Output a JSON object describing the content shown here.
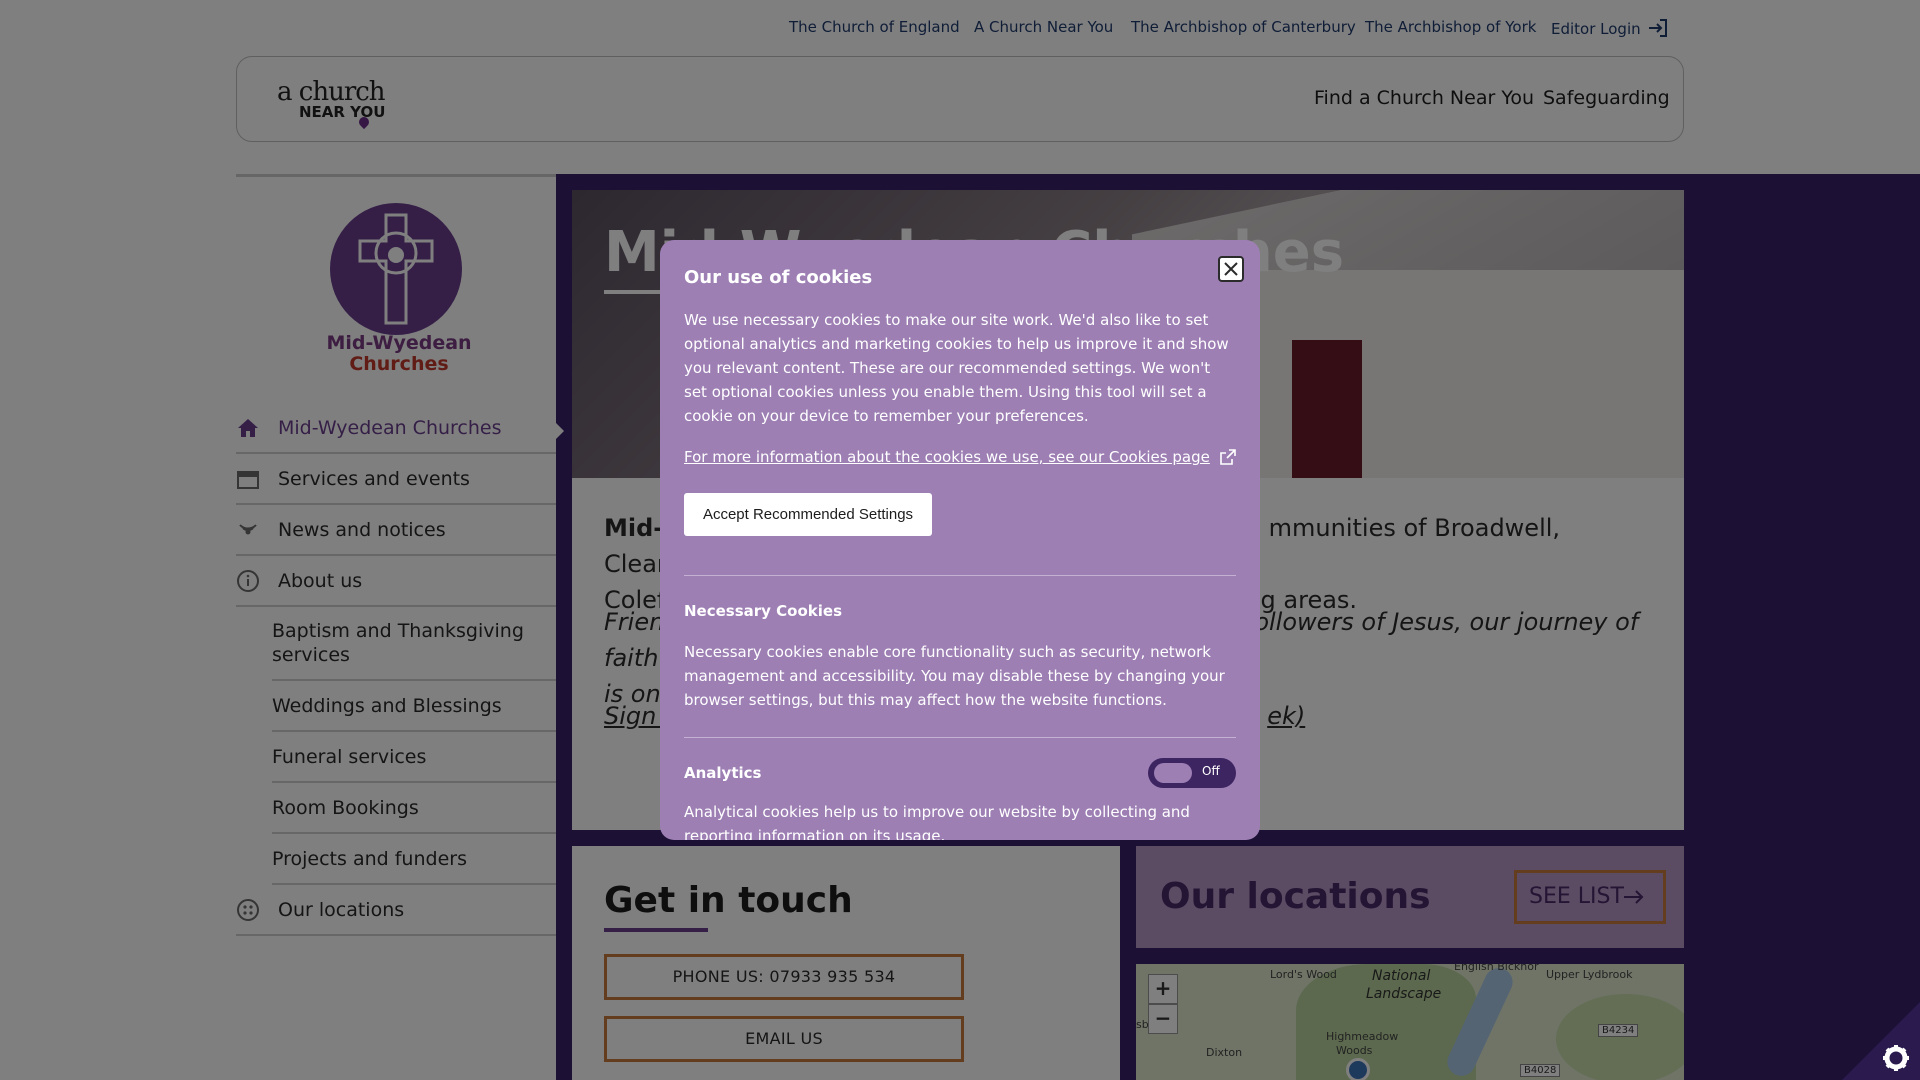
{
  "top_links": [
    {
      "label": "The Church of England"
    },
    {
      "label": "A Church Near You"
    },
    {
      "label": "The Archbishop of Canterbury"
    },
    {
      "label": "The Archbishop of York"
    },
    {
      "label": "Editor Login"
    }
  ],
  "logo": {
    "top": "a church",
    "bottom": "NEAR YOU"
  },
  "main_nav": [
    {
      "label": "Find a Church Near You"
    },
    {
      "label": "Safeguarding"
    }
  ],
  "church": {
    "name_line1": "Mid-Wyedean",
    "name_line2": "Churches"
  },
  "sidebar": {
    "items": [
      {
        "label": "Mid-Wyedean Churches",
        "icon": "home-icon"
      },
      {
        "label": "Services and events",
        "icon": "calendar-icon"
      },
      {
        "label": "News and notices",
        "icon": "broadcast-icon"
      },
      {
        "label": "About us",
        "icon": "info-icon"
      },
      {
        "label": "Baptism and Thanksgiving services"
      },
      {
        "label": "Weddings and Blessings"
      },
      {
        "label": "Funeral services"
      },
      {
        "label": "Room Bookings"
      },
      {
        "label": "Projects and funders"
      },
      {
        "label": "Our locations",
        "icon": "locations-icon"
      }
    ]
  },
  "hero": {
    "title": "Mid-Wyedean Churches"
  },
  "intro": {
    "p1_strong": "Mid-W",
    "p1_rest": "mmunities of Broadwell, Clearwell,",
    "p1_line2a": "Colef",
    "p1_line2b": "ng areas.",
    "p2a": "Frien",
    "p2b": "ollowers of Jesus, our journey of faith",
    "p2c": "is one",
    "p3a": "Sign u",
    "p3b": "ek)"
  },
  "touch": {
    "title": "Get in touch",
    "phone": "PHONE US: 07933 935 534",
    "email": "EMAIL US"
  },
  "locations": {
    "title": "Our locations",
    "see_list": "SEE LIST"
  },
  "map": {
    "zoom_in": "+",
    "zoom_out": "−",
    "labels": {
      "national": "National",
      "landscape": "Landscape",
      "lords_wood": "Lord's Wood",
      "english_bicknor": "English Bicknor",
      "upper_lydbrook": "Upper Lydbrook",
      "highmeadow": "Highmeadow",
      "woods": "Woods",
      "dixton": "Dixton",
      "b4234": "B4234",
      "b4028": "B4028",
      "sb": "sb"
    }
  },
  "cookie": {
    "title": "Our use of cookies",
    "intro": "We use necessary cookies to make our site work. We'd also like to set optional analytics and marketing cookies to help us improve it and show you relevant content. These are our recommended settings. We won't set optional cookies unless you enable them. Using this tool will set a cookie on your device to remember your preferences.",
    "more_info": "For more information about the cookies we use, see our Cookies page",
    "accept": "Accept Recommended Settings",
    "necessary_title": "Necessary Cookies",
    "necessary_text": "Necessary cookies enable core functionality such as security, network management and accessibility. You may disable these by changing your browser settings, but this may affect how the website functions.",
    "analytics_title": "Analytics",
    "analytics_toggle": "Off",
    "analytics_text": "Analytical cookies help us to improve our website by collecting and reporting information on its usage."
  },
  "colors": {
    "purple_band": "#3b206a",
    "modal_bg": "#9d7fb4",
    "accent_orange": "#c77a3a",
    "church_purple": "#6b3e8e"
  }
}
